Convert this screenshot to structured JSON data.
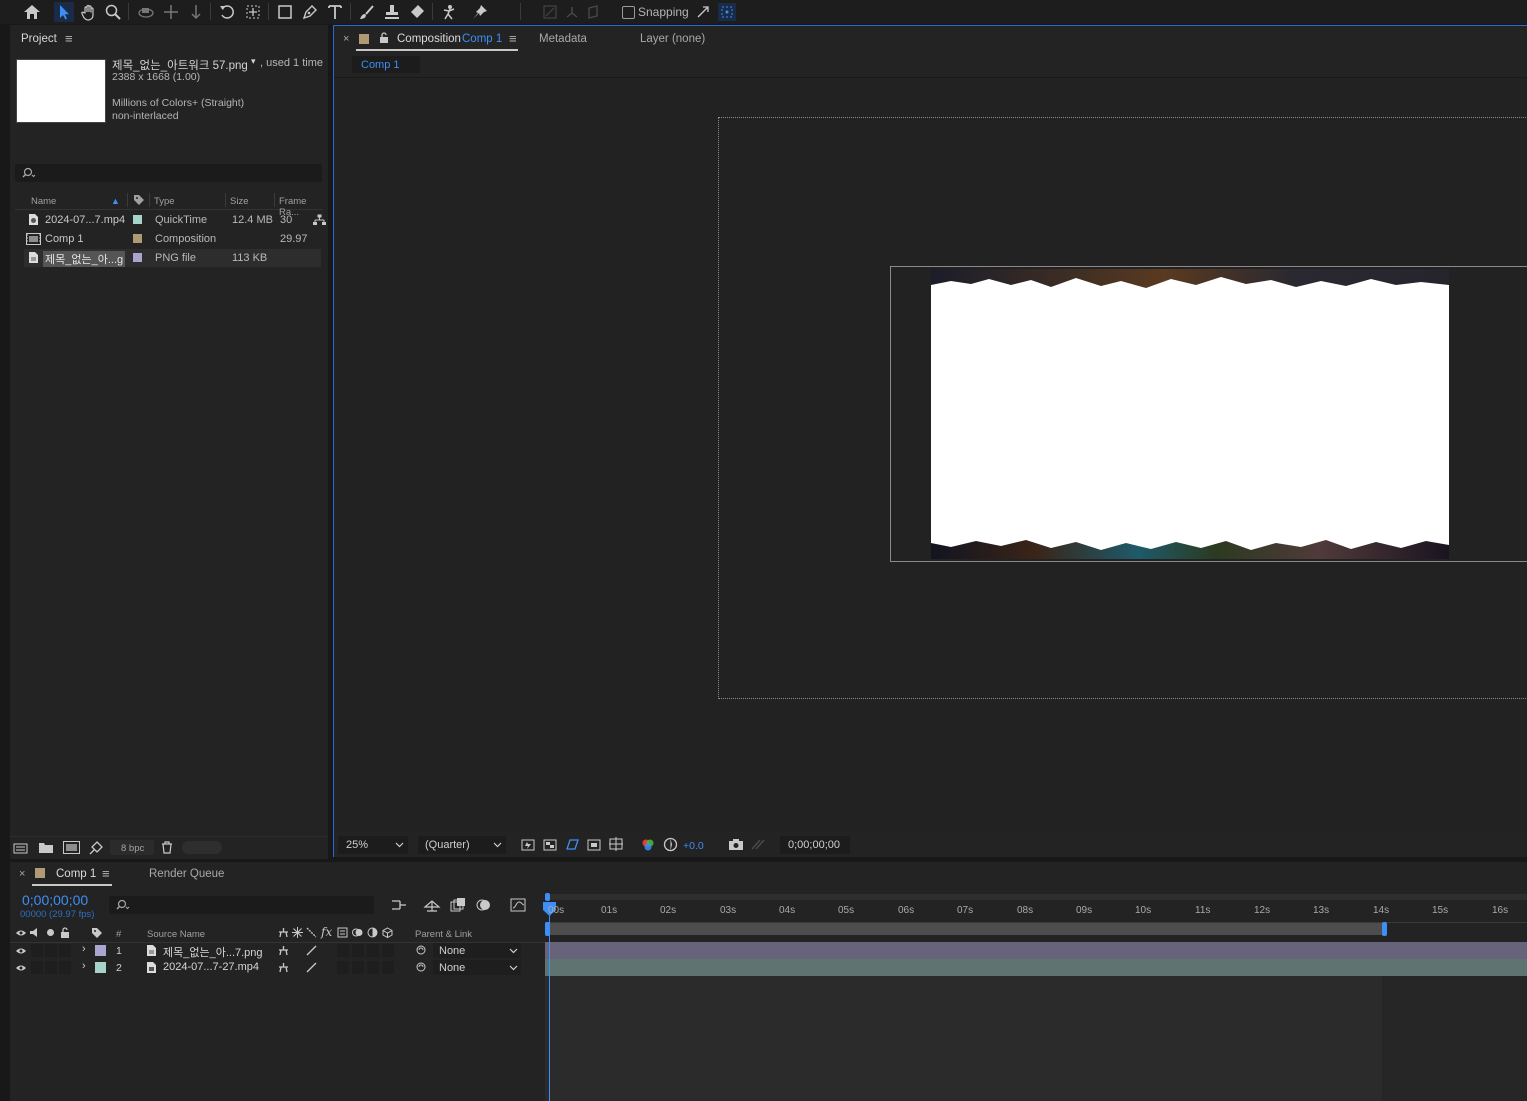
{
  "toolbar": {
    "snapping_label": "Snapping",
    "icons": [
      "home-icon",
      "selection-tool-icon",
      "hand-tool-icon",
      "zoom-tool-icon",
      "orbit-camera-icon",
      "pan-camera-icon",
      "dolly-camera-icon",
      "rotate-tool-icon",
      "pan-behind-icon",
      "rectangle-tool-icon",
      "pen-tool-icon",
      "type-tool-icon",
      "brush-tool-icon",
      "clone-stamp-icon",
      "eraser-tool-icon",
      "roto-brush-icon",
      "puppet-pin-icon"
    ]
  },
  "project": {
    "tab_label": "Project",
    "preview": {
      "filename": "제목_없는_아트워크 57.png",
      "usage": ", used 1 time",
      "dimensions": "2388 x 1668 (1.00)",
      "colors": "Millions of Colors+ (Straight)",
      "interlace": "non-interlaced"
    },
    "columns": {
      "name": "Name",
      "type": "Type",
      "size": "Size",
      "frame_rate": "Frame Ra..."
    },
    "items": [
      {
        "name": "2024-07...7.mp4",
        "type": "QuickTime",
        "size": "12.4 MB",
        "fps": "30",
        "label_color": "#a6d3c9"
      },
      {
        "name": "Comp 1",
        "type": "Composition",
        "size": "",
        "fps": "29.97",
        "label_color": "#b09a74"
      },
      {
        "name": "제목_없는_아...g",
        "type": "PNG file",
        "size": "113 KB",
        "fps": "",
        "label_color": "#a9a5cf"
      }
    ],
    "bpc_label": "8 bpc"
  },
  "composition": {
    "tab_prefix": "Composition",
    "tab_comp_name": "Comp 1",
    "metadata_tab": "Metadata",
    "layer_tab": "Layer (none)",
    "breadcrumb": "Comp 1",
    "footer": {
      "zoom": "25%",
      "resolution": "(Quarter)",
      "exposure": "+0.0",
      "timecode": "0;00;00;00"
    }
  },
  "timeline": {
    "tab_label": "Comp 1",
    "render_queue_label": "Render Queue",
    "timecode": "0;00;00;00",
    "frame_info": "00000 (29.97 fps)",
    "headers": {
      "num": "#",
      "source_name": "Source Name",
      "parent_link": "Parent & Link"
    },
    "ruler": [
      "00s",
      "01s",
      "02s",
      "03s",
      "04s",
      "05s",
      "06s",
      "07s",
      "08s",
      "09s",
      "10s",
      "11s",
      "12s",
      "13s",
      "14s",
      "15s",
      "16s"
    ],
    "layers": [
      {
        "num": "1",
        "name": "제목_없는_아...7.png",
        "parent": "None",
        "label_color": "#a9a5cf"
      },
      {
        "num": "2",
        "name": "2024-07...7-27.mp4",
        "parent": "None",
        "label_color": "#a6d3c9"
      }
    ],
    "colors": {
      "accent": "#2d8ceb",
      "layer1_bar": "#67637a",
      "layer2_bar": "#5f7371"
    }
  }
}
